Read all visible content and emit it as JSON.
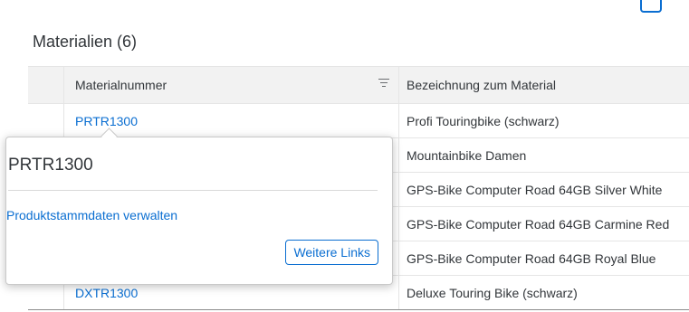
{
  "table": {
    "title": "Materialien (6)",
    "headers": {
      "material_number": "Materialnummer",
      "description": "Bezeichnung zum Material"
    },
    "rows": [
      {
        "number": "PRTR1300",
        "description": "Profi Touringbike (schwarz)"
      },
      {
        "number": "",
        "description": "Mountainbike Damen"
      },
      {
        "number": "",
        "description": "GPS-Bike Computer Road 64GB Silver White"
      },
      {
        "number": "",
        "description": "GPS-Bike Computer Road 64GB Carmine Red"
      },
      {
        "number": "",
        "description": "GPS-Bike Computer Road 64GB Royal Blue"
      },
      {
        "number": "DXTR1300",
        "description": "Deluxe Touring Bike (schwarz)"
      }
    ]
  },
  "popover": {
    "title": "PRTR1300",
    "link": "Produktstammdaten verwalten",
    "button": "Weitere Links"
  },
  "colors": {
    "accent": "#0a6ed1",
    "text": "#32363a",
    "header_bg": "#f2f2f2"
  },
  "icons": {
    "sort": "sort-lines-icon"
  }
}
